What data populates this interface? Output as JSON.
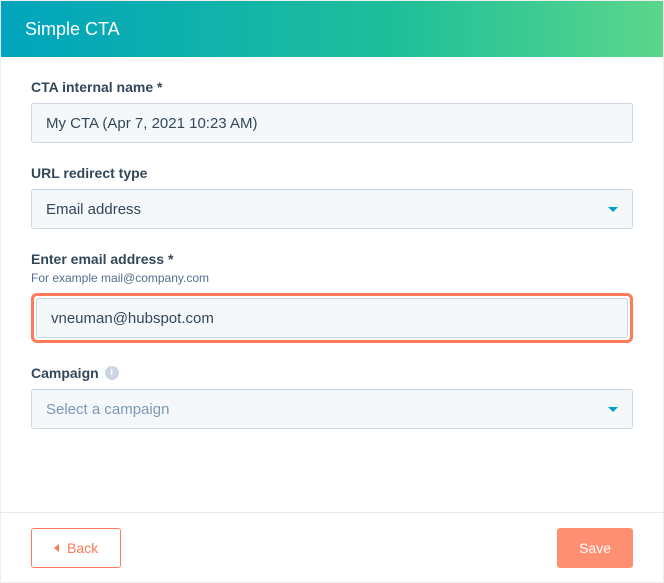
{
  "header": {
    "title": "Simple CTA"
  },
  "fields": {
    "internalName": {
      "label": "CTA internal name *",
      "value": "My CTA (Apr 7, 2021 10:23 AM)"
    },
    "redirectType": {
      "label": "URL redirect type",
      "value": "Email address"
    },
    "email": {
      "label": "Enter email address *",
      "helper": "For example mail@company.com",
      "value": "vneuman@hubspot.com"
    },
    "campaign": {
      "label": "Campaign",
      "placeholder": "Select a campaign"
    }
  },
  "footer": {
    "back": "Back",
    "save": "Save"
  }
}
